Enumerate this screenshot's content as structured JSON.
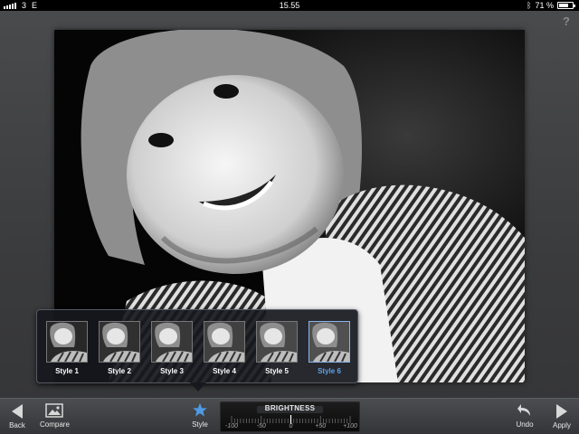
{
  "status_bar": {
    "carrier": "3",
    "network": "E",
    "time": "15.55",
    "battery": "71 %",
    "battery_level": 0.71,
    "icons": [
      "signal-icon",
      "bluetooth-icon",
      "battery-icon"
    ]
  },
  "help": {
    "label": "?"
  },
  "style_picker": {
    "items": [
      {
        "label": "Style 1",
        "selected": false
      },
      {
        "label": "Style 2",
        "selected": false
      },
      {
        "label": "Style 3",
        "selected": false
      },
      {
        "label": "Style 4",
        "selected": false
      },
      {
        "label": "Style 5",
        "selected": false
      },
      {
        "label": "Style 6",
        "selected": true
      }
    ],
    "selected_color": "#5fa2e6"
  },
  "toolbar": {
    "back_label": "Back",
    "compare_label": "Compare",
    "style_label": "Style",
    "undo_label": "Undo",
    "apply_label": "Apply",
    "style_icon_color": "#4f9be6"
  },
  "brightness": {
    "title": "BRIGHTNESS",
    "ticks": [
      "-100",
      "-50",
      "0",
      "+50",
      "+100"
    ],
    "value": 0
  }
}
